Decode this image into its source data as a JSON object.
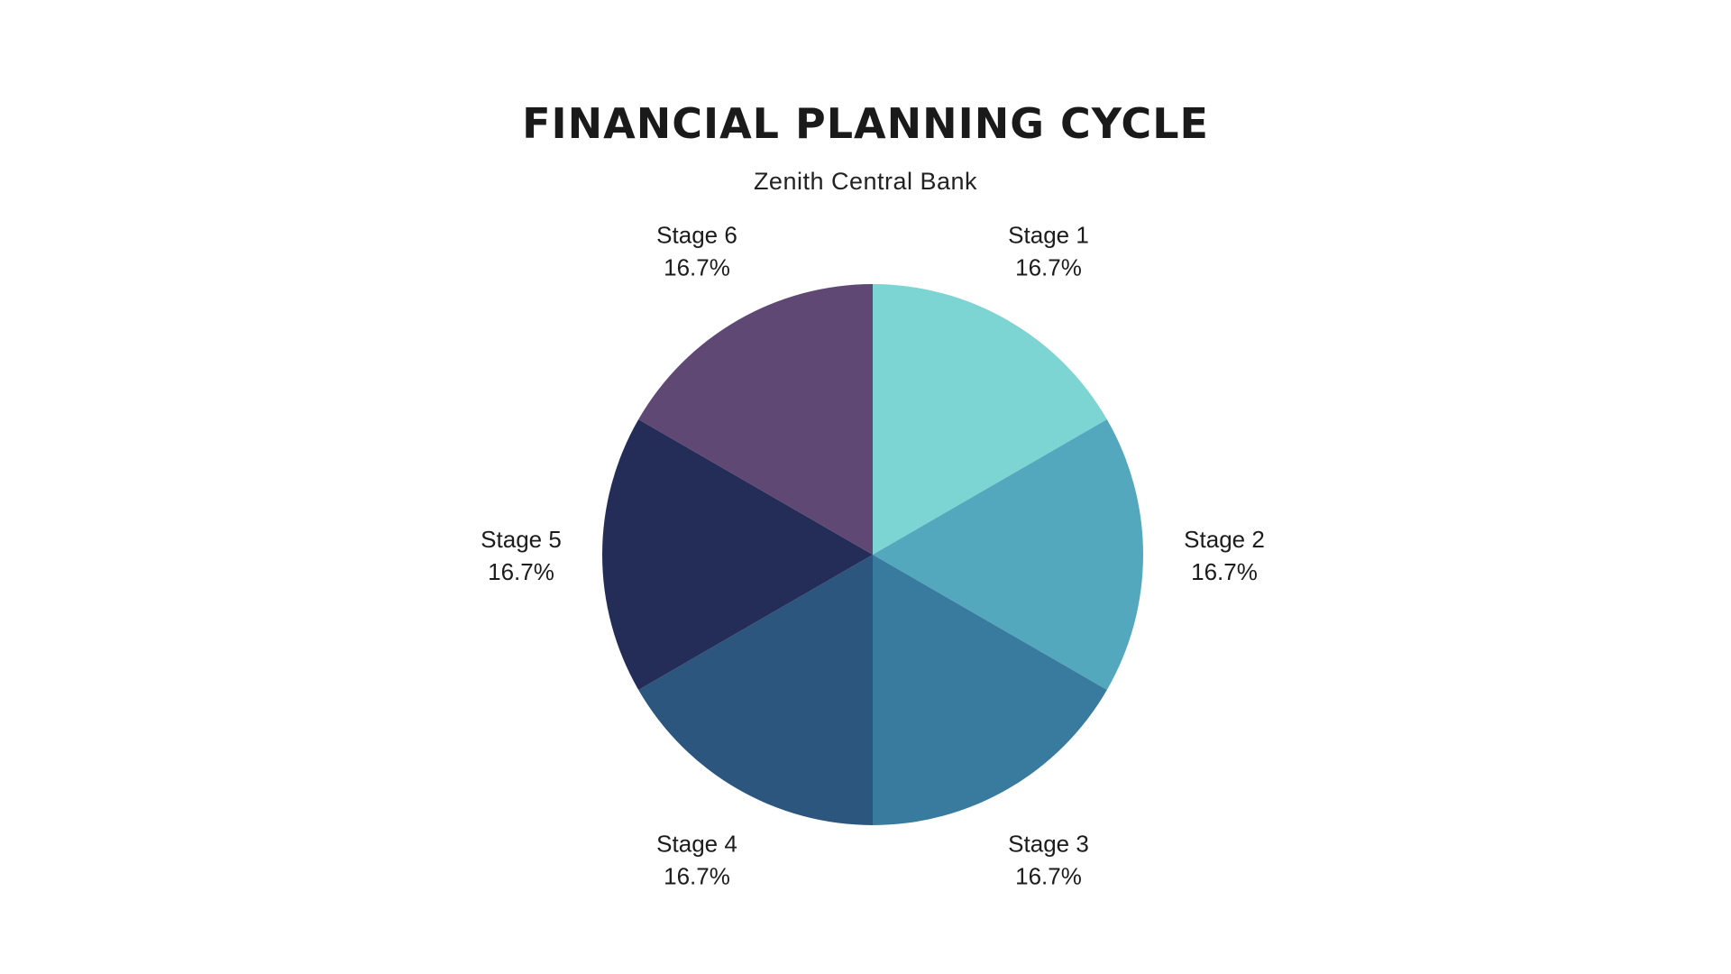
{
  "chart_data": {
    "type": "pie",
    "title": "FINANCIAL PLANNING CYCLE",
    "subtitle": "Zenith Central Bank",
    "slices": [
      {
        "label": "Stage 1",
        "value": 16.7,
        "value_label": "16.7%",
        "color": "#7dd5d3"
      },
      {
        "label": "Stage 2",
        "value": 16.7,
        "value_label": "16.7%",
        "color": "#53a8bd"
      },
      {
        "label": "Stage 3",
        "value": 16.7,
        "value_label": "16.7%",
        "color": "#387b9e"
      },
      {
        "label": "Stage 4",
        "value": 16.7,
        "value_label": "16.7%",
        "color": "#2d567e"
      },
      {
        "label": "Stage 5",
        "value": 16.7,
        "value_label": "16.7%",
        "color": "#242d58"
      },
      {
        "label": "Stage 6",
        "value": 16.7,
        "value_label": "16.7%",
        "color": "#5f4873"
      }
    ],
    "start_angle": "top",
    "direction": "clockwise",
    "labels_outside": true
  }
}
